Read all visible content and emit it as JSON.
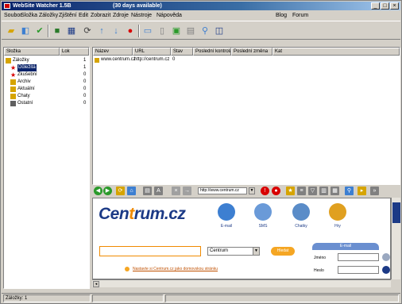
{
  "window": {
    "title": "WebSite Watcher 1.5B",
    "trial": "(30 days available)",
    "min": "_",
    "max": "□",
    "close": "×"
  },
  "menu": [
    "Soubor",
    "Složka",
    "Záložky",
    "Zjištění",
    "Edit",
    "Zobrazit",
    "Zdroje",
    "Nástroje",
    "Nápověda",
    "Blog",
    "Forum"
  ],
  "toolbar": {
    "icons": [
      "folder-open-icon",
      "new-bookmark-icon",
      "check-icon",
      "save-icon",
      "grid-icon",
      "refresh-icon",
      "up-icon",
      "down-icon",
      "stop-icon",
      "window-icon",
      "page-icon",
      "picture-icon",
      "sheet-icon",
      "search-icon",
      "browser-icon"
    ]
  },
  "tree": {
    "col_name": "Složka",
    "col_count": "Lok",
    "root": "Záložky",
    "root_count": "1",
    "items": [
      {
        "label": "Důležitá",
        "count": "1",
        "icon": "star-icon",
        "color": "#d80000"
      },
      {
        "label": "Zkušební",
        "count": "0",
        "icon": "star-icon",
        "color": "#d80000"
      },
      {
        "label": "Archiv",
        "count": "0",
        "icon": "folder-icon",
        "color": "#d6a400"
      },
      {
        "label": "Aktuální",
        "count": "0",
        "icon": "folder-icon",
        "color": "#d6a400"
      },
      {
        "label": "Chaty",
        "count": "0",
        "icon": "folder-icon",
        "color": "#d6a400"
      },
      {
        "label": "Ostatní",
        "count": "0",
        "icon": "trash-icon",
        "color": "#606060"
      }
    ]
  },
  "list": {
    "columns": [
      "Název",
      "URL",
      "Stav",
      "Poslední kontrola",
      "Poslední změna",
      "Kat"
    ],
    "rows": [
      {
        "name": "www.centrum.cz",
        "url": "http://centrum.cz",
        "status": "0"
      }
    ]
  },
  "browser": {
    "url": "http://www.centrum.cz",
    "go": "▼",
    "logo_a": "Cen",
    "logo_b": "t",
    "logo_c": "rum.cz",
    "services": [
      {
        "label": "E-mail",
        "color": "#3d7fd1"
      },
      {
        "label": "SMS",
        "color": "#6a9ad8"
      },
      {
        "label": "Chatky",
        "color": "#5a8cc8"
      },
      {
        "label": "Hry",
        "color": "#e0a020"
      }
    ],
    "search_select": "Centrum",
    "search_button": "Hledat",
    "search_link": "Nastavte si Centrum.cz jako domovskou stránku",
    "email_tab": "E-mail",
    "email_user_label": "Jméno",
    "email_pass_label": "Heslo"
  },
  "statusbar": {
    "left": "Záložky: 1"
  }
}
